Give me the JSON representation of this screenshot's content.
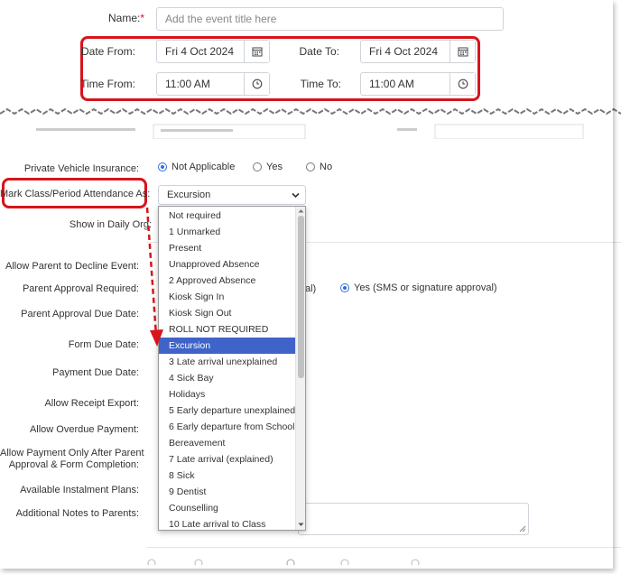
{
  "top": {
    "name_label": "Name:",
    "required_mark": "*",
    "name_placeholder": "Add the event title here",
    "date_from_label": "Date From:",
    "date_from_value": "Fri 4 Oct 2024",
    "date_to_label": "Date To:",
    "date_to_value": "Fri 4 Oct 2024",
    "time_from_label": "Time From:",
    "time_from_value": "11:00 AM",
    "time_to_label": "Time To:",
    "time_to_value": "11:00 AM"
  },
  "form": {
    "vehicle_label": "Private Vehicle Insurance:",
    "vehicle_options": [
      "Not Applicable",
      "Yes",
      "No"
    ],
    "vehicle_selected": "Not Applicable",
    "attendance_label": "Mark Class/Period Attendance As:",
    "attendance_value": "Excursion",
    "daily_org_label": "Show in Daily Org:",
    "decline_label": "Allow Parent to Decline Event:",
    "approval_label": "Parent Approval Required:",
    "approval_partial": "al)",
    "approval_yes": "Yes (SMS or signature approval)",
    "approval_due_label": "Parent Approval Due Date:",
    "form_due_label": "Form Due Date:",
    "payment_due_label": "Payment Due Date:",
    "receipt_label": "Allow Receipt Export:",
    "overdue_label": "Allow Overdue Payment:",
    "payment_only_label_1": "Allow Payment Only After Parent",
    "payment_only_label_2": "Approval & Form Completion:",
    "instalment_label": "Available Instalment Plans:",
    "notes_label": "Additional Notes to Parents:"
  },
  "dropdown": {
    "items": [
      "Not required",
      "1 Unmarked",
      "Present",
      "Unapproved Absence",
      "2 Approved Absence",
      "Kiosk Sign In",
      "Kiosk Sign Out",
      "ROLL NOT REQUIRED",
      "Excursion",
      "3 Late arrival unexplained",
      "4 Sick Bay",
      "Holidays",
      "5 Early departure unexplained",
      "6 Early departure from School",
      "Bereavement",
      "7 Late arrival (explained)",
      "8 Sick",
      "9 Dentist",
      "Counselling",
      "10 Late arrival to Class"
    ],
    "selected_index": 8
  },
  "colors": {
    "highlight": "#d7141c",
    "selected_bg": "#3f63c9",
    "radio_accent": "#2f6fd6"
  },
  "icons": [
    "calendar-icon",
    "clock-icon",
    "chevron-down-icon",
    "arrow-annotation"
  ]
}
